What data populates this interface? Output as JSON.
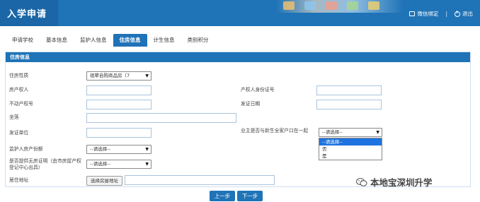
{
  "header": {
    "title": "入学申请",
    "wechat_label": "微信绑定",
    "separator": "|",
    "logout_label": "退出"
  },
  "tabs": [
    {
      "label": "申请学校",
      "active": false
    },
    {
      "label": "基本信息",
      "active": false
    },
    {
      "label": "监护人信息",
      "active": false
    },
    {
      "label": "住房信息",
      "active": true
    },
    {
      "label": "计生信息",
      "active": false
    },
    {
      "label": "类别积分",
      "active": false
    }
  ],
  "panel": {
    "title": "住房信息",
    "fields": {
      "housing_type": {
        "label": "住房性质",
        "value": "祖辈自购商品房（7"
      },
      "owner": {
        "label": "房产权人",
        "value": ""
      },
      "owner_id": {
        "label": "产权人身份证号",
        "value": ""
      },
      "property_no": {
        "label": "不动产权号",
        "value": ""
      },
      "issue_date": {
        "label": "发证日期",
        "value": ""
      },
      "seat": {
        "label": "坐落",
        "value": ""
      },
      "issuer": {
        "label": "发证单位",
        "value": ""
      },
      "same_hukou": {
        "label": "业主是否与新生全家户口在一起",
        "value": "--请选择--"
      },
      "guardian_share": {
        "label": "监护人房产份额",
        "value": "--请选择--"
      },
      "no_house_cert": {
        "label": "是否提供无房证明（由市房屋产权登记中心出具）",
        "value": "--请选择--"
      },
      "address": {
        "label": "居住地址",
        "button": "选择房屋地址",
        "value": ""
      }
    },
    "dropdown_options": [
      "--请选择--",
      "否",
      "是"
    ]
  },
  "buttons": {
    "prev": "上一步",
    "next": "下一步"
  },
  "watermark": "本地宝深圳升学",
  "colors": {
    "primary": "#1f73b7",
    "highlight": "#1e73e0",
    "input_border": "#a9c3dc"
  }
}
